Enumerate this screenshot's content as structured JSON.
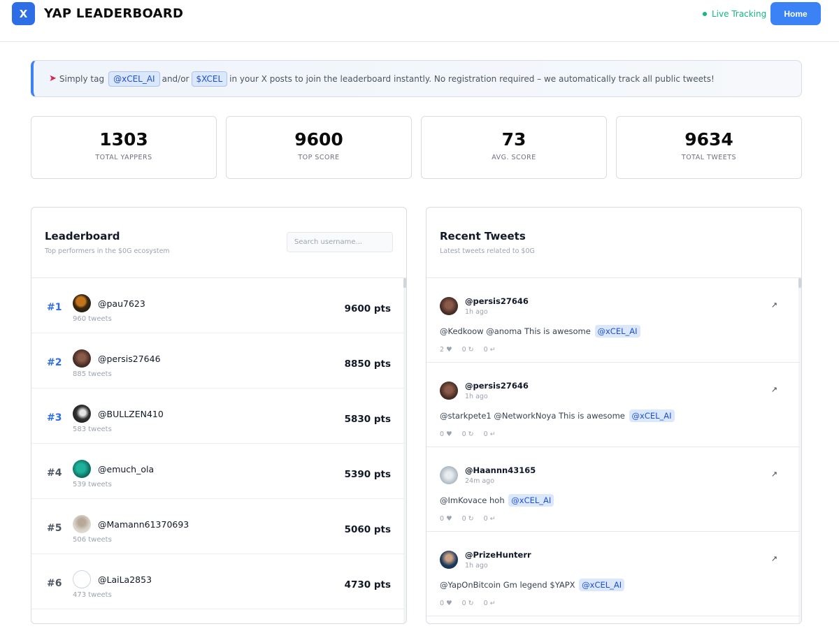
{
  "header": {
    "logo_letter": "X",
    "title": "YAP LEADERBOARD",
    "live_status": "Live Tracking",
    "home_label": "Home"
  },
  "banner": {
    "icon": "rocket-icon",
    "prefix": "Simply tag",
    "tag1": "@xCEL_AI",
    "connector": "and/or",
    "tag2": "$XCEL",
    "suffix": "in your X posts to join the leaderboard instantly. No registration required – we automatically track all public tweets!"
  },
  "stats": [
    {
      "value": "1303",
      "label": "TOTAL YAPPERS"
    },
    {
      "value": "9600",
      "label": "TOP SCORE"
    },
    {
      "value": "73",
      "label": "AVG. SCORE"
    },
    {
      "value": "9634",
      "label": "TOTAL TWEETS"
    }
  ],
  "leaderboard": {
    "title": "Leaderboard",
    "subtitle": "Top performers in the $0G ecosystem",
    "search_placeholder": "Search username...",
    "rows": [
      {
        "rank": "#1",
        "username": "@pau7623",
        "tweets": "960 tweets",
        "score": "9600 pts"
      },
      {
        "rank": "#2",
        "username": "@persis27646",
        "tweets": "885 tweets",
        "score": "8850 pts"
      },
      {
        "rank": "#3",
        "username": "@BULLZEN410",
        "tweets": "583 tweets",
        "score": "5830 pts"
      },
      {
        "rank": "#4",
        "username": "@emuch_ola",
        "tweets": "539 tweets",
        "score": "5390 pts"
      },
      {
        "rank": "#5",
        "username": "@Mamann61370693",
        "tweets": "506 tweets",
        "score": "5060 pts"
      },
      {
        "rank": "#6",
        "username": "@LaiLa2853",
        "tweets": "473 tweets",
        "score": "4730 pts"
      }
    ]
  },
  "recent": {
    "title": "Recent Tweets",
    "subtitle": "Latest tweets related to $0G",
    "tweets": [
      {
        "username": "@persis27646",
        "time": "1h ago",
        "text": "@Kedkoow @anoma This is awesome",
        "tag": "@xCEL_AI",
        "likes": "2 ♥",
        "retweets": "0 ↻",
        "replies": "0 ↵"
      },
      {
        "username": "@persis27646",
        "time": "1h ago",
        "text": "@starkpete1 @NetworkNoya This is awesome",
        "tag": "@xCEL_AI",
        "likes": "0 ♥",
        "retweets": "0 ↻",
        "replies": "0 ↵"
      },
      {
        "username": "@Haannn43165",
        "time": "24m ago",
        "text": "@ImKovace hoh",
        "tag": "@xCEL_AI",
        "likes": "0 ♥",
        "retweets": "0 ↻",
        "replies": "0 ↵"
      },
      {
        "username": "@PrizeHunterr",
        "time": "1h ago",
        "text": "@YapOnBitcoin Gm legend $YAPX",
        "tag": "@xCEL_AI",
        "likes": "0 ♥",
        "retweets": "0 ↻",
        "replies": "0 ↵"
      }
    ]
  },
  "colors": {
    "accent": "#3b82f6",
    "rank_highlight": "#2d6ee6",
    "rank_normal": "#4b5563",
    "live_green": "#10b981"
  }
}
